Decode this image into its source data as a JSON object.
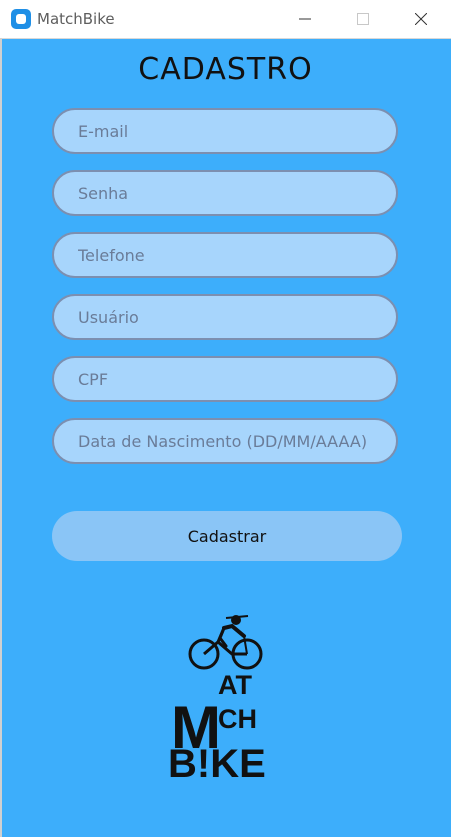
{
  "window": {
    "title": "MatchBike",
    "app_icon": "app-icon",
    "controls": [
      "minimize-icon",
      "maximize-icon",
      "close-icon"
    ]
  },
  "form": {
    "title": "CADASTRO",
    "fields": {
      "email": "E-mail",
      "password": "Senha",
      "phone": "Telefone",
      "username": "Usuário",
      "cpf": "CPF",
      "birthdate": "Data de Nascimento (DD/MM/AAAA)"
    },
    "submit_label": "Cadastrar"
  },
  "logo": {
    "line1": "MAT",
    "line2": "CH",
    "line3": "B!KE"
  },
  "colors": {
    "background": "#3daefb",
    "field_background": "#a7d5fc",
    "field_border": "#7c8fb0",
    "button_background": "#8ac5f6"
  }
}
